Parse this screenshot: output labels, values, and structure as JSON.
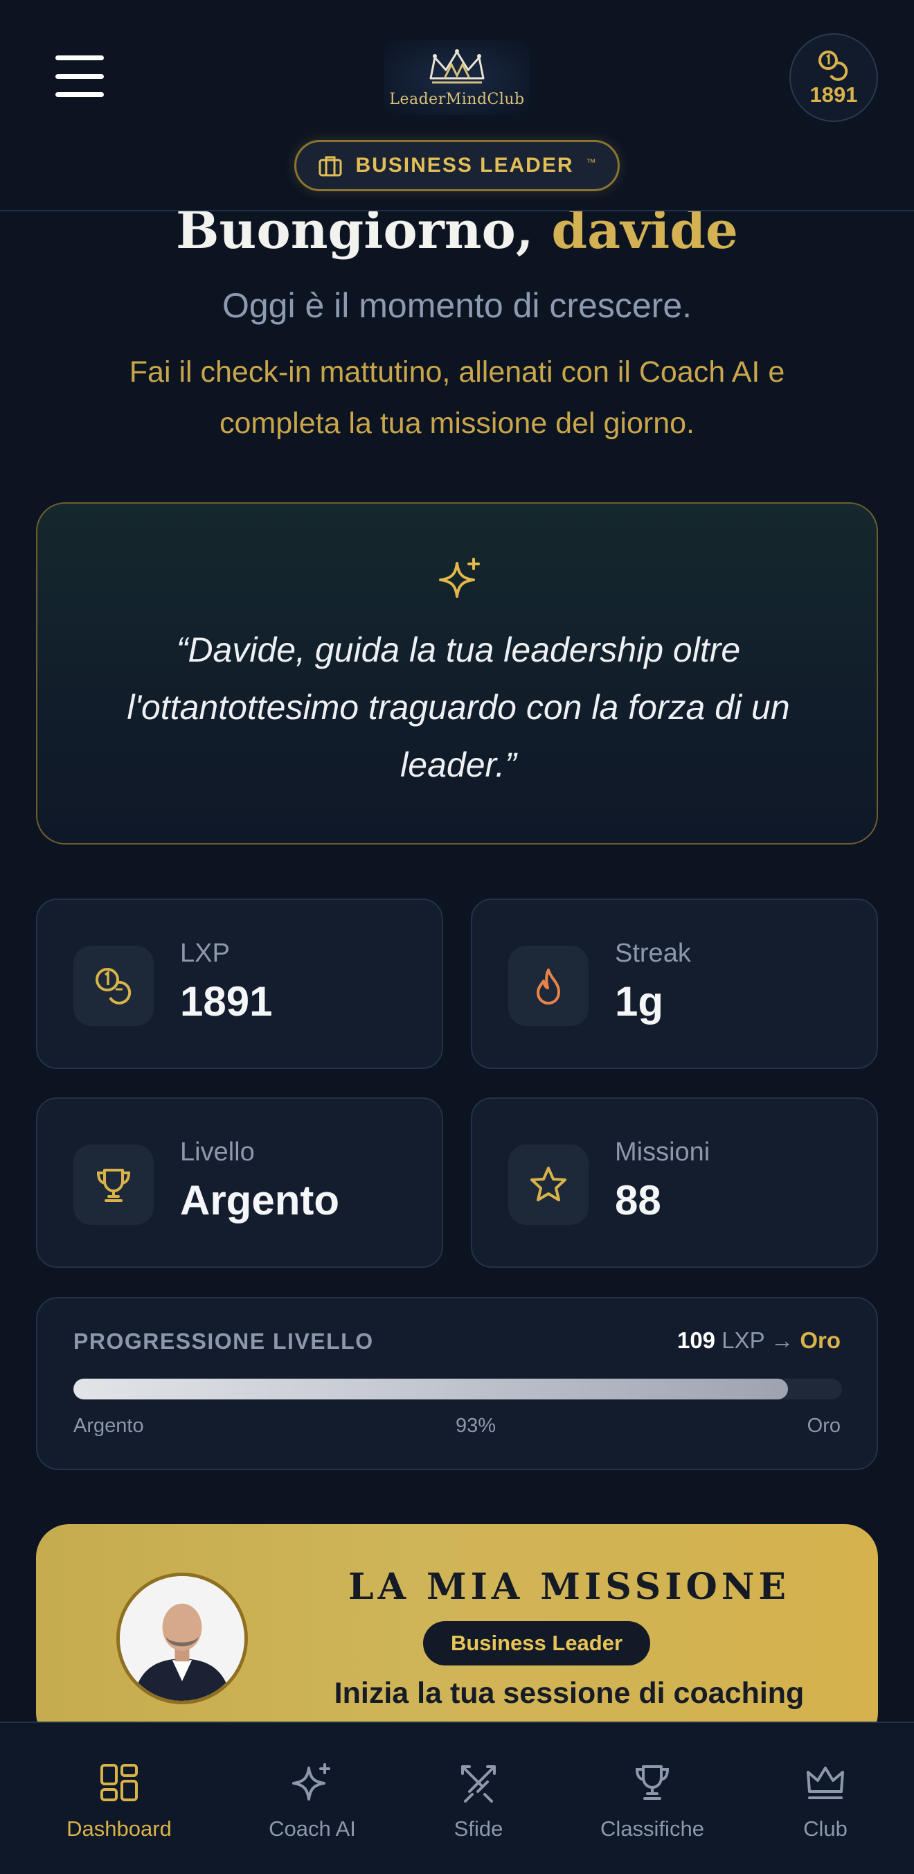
{
  "header": {
    "logo_text": "LeaderMindClub",
    "coins": "1891",
    "role_badge": "BUSINESS LEADER",
    "role_badge_tm": "™"
  },
  "greeting": {
    "hello": "Buongiorno,",
    "name": "davide",
    "subtitle": "Oggi è il momento di crescere.",
    "prompt": "Fai il check-in mattutino, allenati con il Coach AI e completa la tua missione del giorno."
  },
  "quote": {
    "icon": "sparkles-icon",
    "text": "“Davide, guida la tua leadership oltre l'ottantottesimo traguardo con la forza di un leader.”"
  },
  "stats": [
    {
      "label": "LXP",
      "value": "1891",
      "icon": "coins-icon",
      "color": "#d9b34a"
    },
    {
      "label": "Streak",
      "value": "1g",
      "icon": "flame-icon",
      "color": "#e8844a"
    },
    {
      "label": "Livello",
      "value": "Argento",
      "icon": "trophy-icon",
      "color": "#d9b34a"
    },
    {
      "label": "Missioni",
      "value": "88",
      "icon": "star-icon",
      "color": "#d9b34a"
    }
  ],
  "progress": {
    "title": "PROGRESSIONE LIVELLO",
    "remaining": "109",
    "unit": "LXP",
    "arrow": "→",
    "next_level": "Oro",
    "current_level": "Argento",
    "percent_label": "93%",
    "percent": 93
  },
  "mission": {
    "title": "LA MIA MISSIONE",
    "badge": "Business Leader",
    "subtitle": "Inizia la tua sessione di coaching"
  },
  "nav": [
    {
      "label": "Dashboard",
      "icon": "dashboard-icon",
      "active": true
    },
    {
      "label": "Coach AI",
      "icon": "sparkles-icon",
      "active": false
    },
    {
      "label": "Sfide",
      "icon": "swords-icon",
      "active": false
    },
    {
      "label": "Classifiche",
      "icon": "trophy-icon",
      "active": false
    },
    {
      "label": "Club",
      "icon": "crown-icon",
      "active": false
    }
  ],
  "colors": {
    "background": "#0c1422",
    "gold": "#d9b34a",
    "muted": "#8d98ac",
    "card": "#141d2e"
  }
}
